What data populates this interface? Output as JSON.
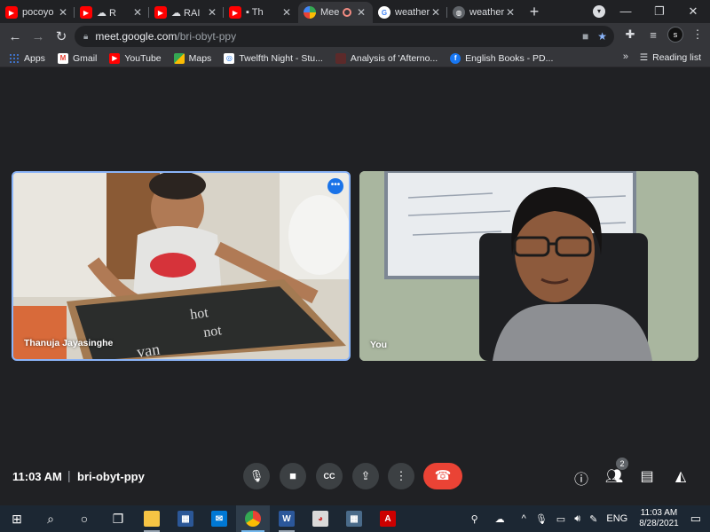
{
  "tabs": [
    {
      "title": "pocoyo",
      "icon": "youtube-icon"
    },
    {
      "title": "☁ R",
      "icon": "youtube-icon"
    },
    {
      "title": "☁ RAI",
      "icon": "youtube-icon"
    },
    {
      "title": "▪ Th",
      "icon": "youtube-icon"
    },
    {
      "title": "Mee",
      "icon": "meet-icon",
      "active": true
    },
    {
      "title": "weather",
      "icon": "google-icon"
    },
    {
      "title": "weather",
      "icon": "globe-icon"
    }
  ],
  "address": {
    "host": "meet.google.com",
    "path": "/bri-obyt-ppy"
  },
  "bookmarks": [
    {
      "label": "Apps",
      "icon": "apps-grid-icon"
    },
    {
      "label": "Gmail",
      "icon": "gmail-icon"
    },
    {
      "label": "YouTube",
      "icon": "youtube-icon"
    },
    {
      "label": "Maps",
      "icon": "maps-icon"
    },
    {
      "label": "Twelfth Night - Stu...",
      "icon": "site-icon"
    },
    {
      "label": "Analysis of 'Afterno...",
      "icon": "site-icon"
    },
    {
      "label": "English Books - PD...",
      "icon": "facebook-icon"
    }
  ],
  "reading_list": "Reading list",
  "participants": [
    {
      "name": "Thanuja Jayasinghe"
    },
    {
      "name": "You"
    }
  ],
  "meeting": {
    "time": "11:03 AM",
    "separator": "|",
    "code": "bri-obyt-ppy",
    "participant_count": "2"
  },
  "taskbar": {
    "language": "ENG",
    "time": "11:03 AM",
    "date": "8/28/2021"
  },
  "colors": {
    "accent": "#8ab4f8",
    "end_call": "#ea4335",
    "browser_bg": "#35363a",
    "meet_bg": "#202124"
  }
}
